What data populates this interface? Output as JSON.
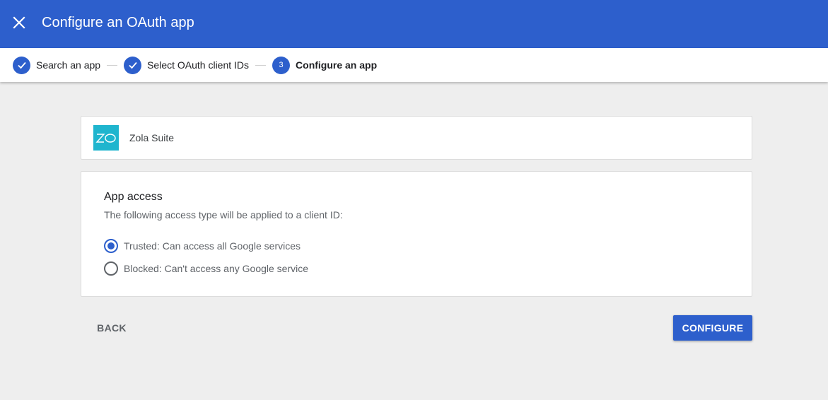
{
  "header": {
    "title": "Configure an OAuth app",
    "close_icon": "close-icon",
    "color": "#2d5fcc"
  },
  "stepper": {
    "steps": [
      {
        "label": "Search an app",
        "state": "done",
        "icon": "check-icon"
      },
      {
        "label": "Select OAuth client IDs",
        "state": "done",
        "icon": "check-icon"
      },
      {
        "label": "Configure an app",
        "state": "active",
        "number": "3"
      }
    ]
  },
  "app": {
    "name": "Zola Suite",
    "logo_text": "ZO",
    "logo_color": "#1fb5ce"
  },
  "access": {
    "title": "App access",
    "description": "The following access type will be applied to a client ID:",
    "options": [
      {
        "label": "Trusted: Can access all Google services",
        "selected": true
      },
      {
        "label": "Blocked: Can't access any Google service",
        "selected": false
      }
    ]
  },
  "actions": {
    "back_label": "BACK",
    "configure_label": "CONFIGURE"
  }
}
